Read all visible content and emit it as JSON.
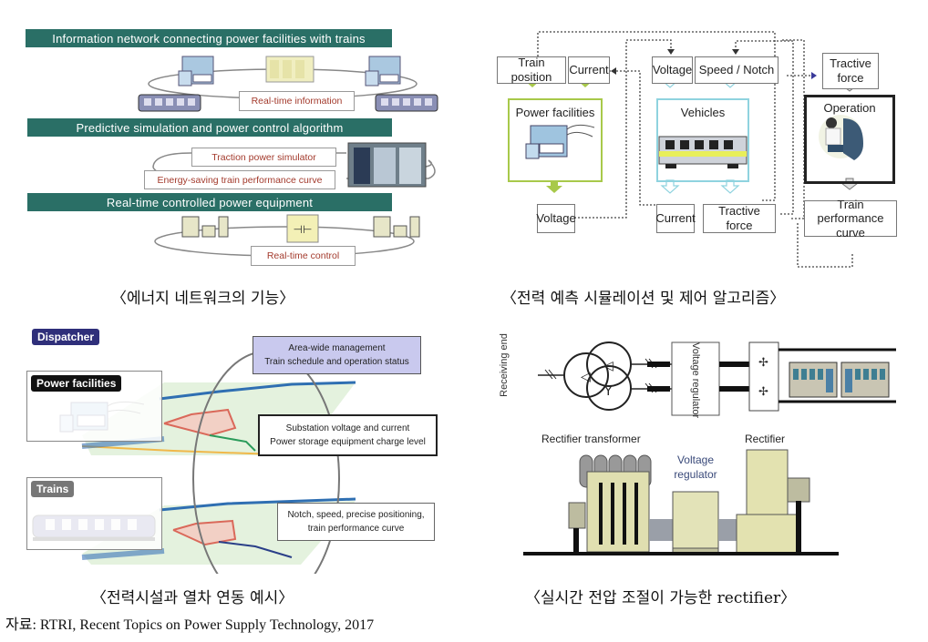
{
  "panels": {
    "energy_network": {
      "bars": [
        "Information network connecting power facilities with trains",
        "Predictive simulation and power control algorithm",
        "Real-time controlled power equipment"
      ],
      "labels": {
        "realtime_info": "Real-time information",
        "traction_sim": "Traction power simulator",
        "energy_curve": "Energy-saving train performance curve",
        "realtime_control": "Real-time control"
      },
      "caption": "〈에너지 네트워크의 기능〉"
    },
    "simulation": {
      "boxes": {
        "train_position": "Train position",
        "current_in": "Current",
        "voltage_in": "Voltage",
        "speed_notch": "Speed / Notch",
        "tractive_force_in": "Tractive force",
        "power_facilities": "Power facilities",
        "vehicles": "Vehicles",
        "operation": "Operation",
        "voltage_out": "Voltage",
        "current_out": "Current",
        "tractive_force_out": "Tractive force",
        "train_performance_curve": "Train performance curve"
      },
      "caption": "〈전력 예측 시뮬레이션 및 제어 알고리즘〉"
    },
    "linkage": {
      "tags": {
        "dispatcher": "Dispatcher",
        "power_facilities": "Power facilities",
        "trains": "Trains"
      },
      "info": {
        "area_line1": "Area-wide management",
        "area_line2": "Train schedule and operation status",
        "sub_line1": "Substation voltage and current",
        "sub_line2": "Power storage equipment charge level",
        "notch_line1": "Notch, speed, precise positioning,",
        "notch_line2": "train performance curve"
      },
      "caption": "〈전력시설과 열차 연동 예시〉"
    },
    "rectifier": {
      "labels": {
        "receiving_end": "Receiving end",
        "voltage_regulator_box": "Voltage regulator",
        "rectifier_transformer": "Rectifier transformer",
        "voltage_regulator": "Voltage regulator",
        "rectifier": "Rectifier"
      },
      "caption": "〈실시간 전압 조절이 가능한 rectifier〉"
    }
  },
  "source": "자료: RTRI, Recent Topics on Power Supply Technology, 2017",
  "colors": {
    "teal": "#2a6f66",
    "red_text": "#a33a2c",
    "green_border": "#a8c94a",
    "cyan_border": "#8fd3df",
    "dispatcher_bg": "#2f2f7a",
    "area_box_bg": "#c9c9ee"
  }
}
